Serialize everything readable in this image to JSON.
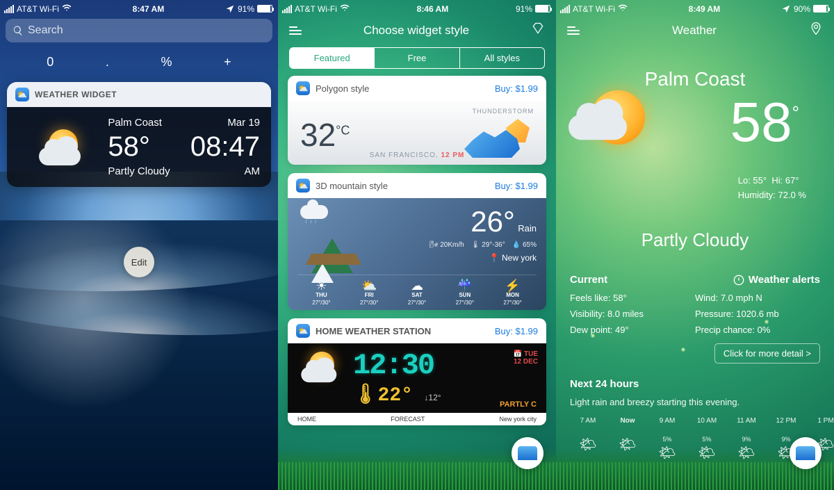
{
  "screen1": {
    "status": {
      "carrier": "AT&T Wi-Fi",
      "time": "8:47 AM",
      "battery_pct": "91%",
      "battery_fill": 91
    },
    "search_placeholder": "Search",
    "controls": [
      "0",
      ".",
      "%",
      "+"
    ],
    "widget_title": "WEATHER WIDGET",
    "city": "Palm Coast",
    "date": "Mar 19",
    "temp": "58°",
    "time": "08:47",
    "condition": "Partly Cloudy",
    "ampm": "AM",
    "edit": "Edit"
  },
  "screen2": {
    "status": {
      "carrier": "AT&T Wi-Fi",
      "time": "8:46 AM",
      "battery_pct": "91%",
      "battery_fill": 91
    },
    "title": "Choose widget style",
    "tabs": [
      "Featured",
      "Free",
      "All styles"
    ],
    "active_tab": 0,
    "styles": [
      {
        "name": "Polygon style",
        "price": "Buy: $1.99",
        "temp": "32",
        "unit": "°C",
        "storm_label": "THUNDERSTORM",
        "loc_city": "SAN FRANCISCO,",
        "loc_time": "12 PM"
      },
      {
        "name": "3D mountain style",
        "price": "Buy: $1.99",
        "temp": "26°",
        "cond": "Rain",
        "wind": "20Km/h",
        "range": "29°-36°",
        "humidity": "65%",
        "loc": "New york",
        "forecast": [
          {
            "day": "THU",
            "hi_lo": "27°/30°",
            "icon": "☀"
          },
          {
            "day": "FRI",
            "hi_lo": "27°/30°",
            "icon": "⛅"
          },
          {
            "day": "SAT",
            "hi_lo": "27°/30°",
            "icon": "☁"
          },
          {
            "day": "SUN",
            "hi_lo": "27°/30°",
            "icon": "☔"
          },
          {
            "day": "MON",
            "hi_lo": "27°/30°",
            "icon": "⚡"
          }
        ]
      },
      {
        "name": "HOME WEATHER STATION",
        "price": "Buy: $1.99",
        "digitime": "12:30",
        "digitemp": "22°",
        "aux_temp": "12°",
        "day_label": "TUE",
        "date_label": "12 DEC",
        "cond": "PARTLY C",
        "footer_left": "HOME",
        "footer_mid": "FORECAST",
        "footer_right": "New york city"
      }
    ]
  },
  "screen3": {
    "status": {
      "carrier": "AT&T Wi-Fi",
      "time": "8:49 AM",
      "battery_pct": "90%",
      "battery_fill": 90
    },
    "title": "Weather",
    "city": "Palm Coast",
    "temp": "58",
    "lo": "Lo: 55°",
    "hi": "Hi: 67°",
    "humidity": "Humidity: 72.0 %",
    "condition": "Partly Cloudy",
    "current_label": "Current",
    "alerts_label": "Weather alerts",
    "details": {
      "feels": "Feels like: 58°",
      "wind": "Wind: 7.0 mph N",
      "vis": "Visibility: 8.0 miles",
      "pressure": "Pressure: 1020.6 mb",
      "dew": "Dew point: 49°",
      "precip": "Precip chance: 0%"
    },
    "more": "Click for more detail >",
    "next24_title": "Next 24 hours",
    "next24_sub": "Light rain and breezy starting this evening.",
    "hours": [
      {
        "t": "7 AM",
        "pct": "",
        "icon": "🌤"
      },
      {
        "t": "Now",
        "pct": "",
        "icon": "🌤"
      },
      {
        "t": "9 AM",
        "pct": "5%",
        "icon": "🌤"
      },
      {
        "t": "10 AM",
        "pct": "5%",
        "icon": "🌤"
      },
      {
        "t": "11 AM",
        "pct": "9%",
        "icon": "🌤"
      },
      {
        "t": "12 PM",
        "pct": "9%",
        "icon": "🌤"
      },
      {
        "t": "1 PM",
        "pct": "",
        "icon": "🌤"
      }
    ]
  }
}
